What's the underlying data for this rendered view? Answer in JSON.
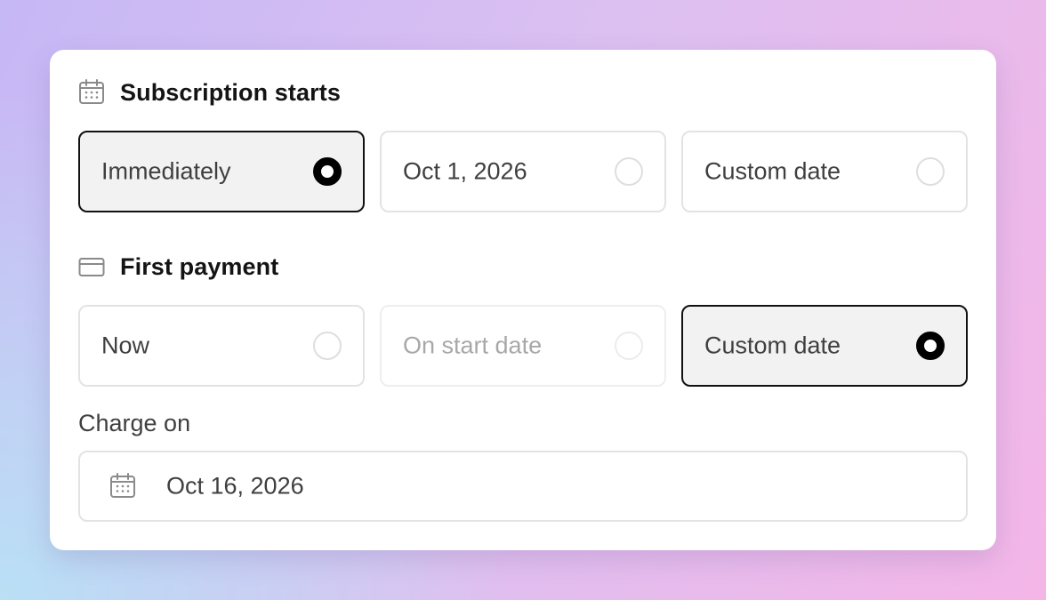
{
  "subscription_start": {
    "title": "Subscription starts",
    "icon": "calendar-icon",
    "options": [
      {
        "label": "Immediately",
        "selected": true,
        "disabled": false
      },
      {
        "label": "Oct 1, 2026",
        "selected": false,
        "disabled": false
      },
      {
        "label": "Custom date",
        "selected": false,
        "disabled": false
      }
    ]
  },
  "first_payment": {
    "title": "First payment",
    "icon": "credit-card-icon",
    "options": [
      {
        "label": "Now",
        "selected": false,
        "disabled": false
      },
      {
        "label": "On start date",
        "selected": false,
        "disabled": true
      },
      {
        "label": "Custom date",
        "selected": true,
        "disabled": false
      }
    ]
  },
  "charge_on": {
    "label": "Charge on",
    "value": "Oct 16, 2026",
    "icon": "calendar-icon"
  },
  "colors": {
    "selected_border": "#111111",
    "selected_fill": "#f2f2f2",
    "border": "#e3e3e3",
    "disabled_text": "#a8a8a8"
  }
}
